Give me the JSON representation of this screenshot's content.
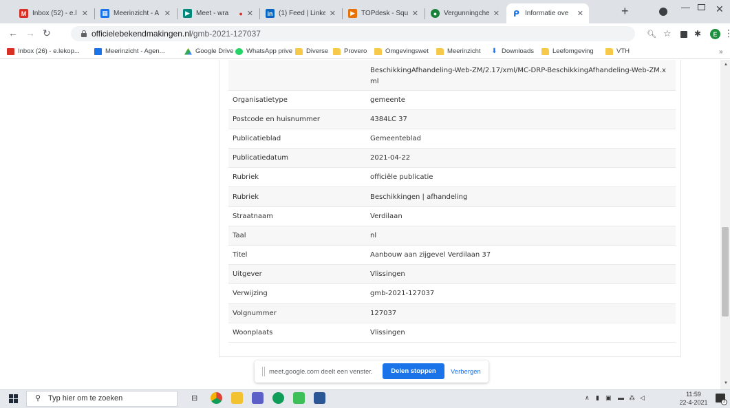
{
  "browser": {
    "tabs": [
      {
        "title": "Inbox (52) - e.l",
        "icon": "gmail-icon",
        "color": "#d93025"
      },
      {
        "title": "Meerinzicht - A",
        "icon": "calendar-icon",
        "color": "#1a73e8"
      },
      {
        "title": "Meet - wra",
        "icon": "meet-icon",
        "color": "#00897b"
      },
      {
        "title": "(1) Feed | Linke",
        "icon": "linkedin-icon",
        "color": "#0a66c2"
      },
      {
        "title": "TOPdesk - Squ",
        "icon": "topdesk-icon",
        "color": "#e8710a"
      },
      {
        "title": "Vergunningche",
        "icon": "vergunning-icon",
        "color": "#188038"
      },
      {
        "title": "Informatie ove",
        "icon": "info-page-icon",
        "color": "#1a73e8",
        "active": true
      }
    ],
    "url_host": "officielebekendmakingen.nl",
    "url_path": "/gmb-2021-127037",
    "profile_initial": "E"
  },
  "bookmarks": [
    {
      "label": "Inbox (26) - e.lekop...",
      "icon": "gmail-icon"
    },
    {
      "label": "Meerinzicht - Agen...",
      "icon": "calendar-icon"
    },
    {
      "label": "Google Drive",
      "icon": "drive-icon"
    },
    {
      "label": "WhatsApp prive",
      "icon": "whatsapp-icon"
    },
    {
      "label": "Diverse",
      "icon": "folder-icon"
    },
    {
      "label": "Provero",
      "icon": "folder-icon"
    },
    {
      "label": "Omgevingswet",
      "icon": "folder-icon"
    },
    {
      "label": "Meerinzicht",
      "icon": "folder-icon"
    },
    {
      "label": "Downloads",
      "icon": "download-icon"
    },
    {
      "label": "Leefomgeving",
      "icon": "folder-icon"
    },
    {
      "label": "VTH",
      "icon": "folder-icon"
    }
  ],
  "page": {
    "top_fragment": "BeschikkingAfhandeling-Web-ZM/2.17/xml/MC-DRP-BeschikkingAfhandeling-Web-ZM.xml",
    "rows": [
      {
        "label": "Organisatietype",
        "value": "gemeente"
      },
      {
        "label": "Postcode en huisnummer",
        "value": "4384LC 37"
      },
      {
        "label": "Publicatieblad",
        "value": "Gemeenteblad"
      },
      {
        "label": "Publicatiedatum",
        "value": "2021-04-22"
      },
      {
        "label": "Rubriek",
        "value": "officiële publicatie"
      },
      {
        "label": "Rubriek",
        "value": "Beschikkingen | afhandeling"
      },
      {
        "label": "Straatnaam",
        "value": "Verdilaan"
      },
      {
        "label": "Taal",
        "value": "nl"
      },
      {
        "label": "Titel",
        "value": "Aanbouw aan zijgevel Verdilaan 37"
      },
      {
        "label": "Uitgever",
        "value": "Vlissingen"
      },
      {
        "label": "Verwijzing",
        "value": "gmb-2021-127037"
      },
      {
        "label": "Volgnummer",
        "value": "127037"
      },
      {
        "label": "Woonplaats",
        "value": "Vlissingen"
      }
    ]
  },
  "share_bar": {
    "text": "meet.google.com deelt een venster.",
    "stop_label": "Delen stoppen",
    "hide_label": "Verbergen"
  },
  "taskbar": {
    "search_placeholder": "Typ hier om te zoeken",
    "time": "11:59",
    "date": "22-4-2021",
    "notification_count": "3"
  }
}
